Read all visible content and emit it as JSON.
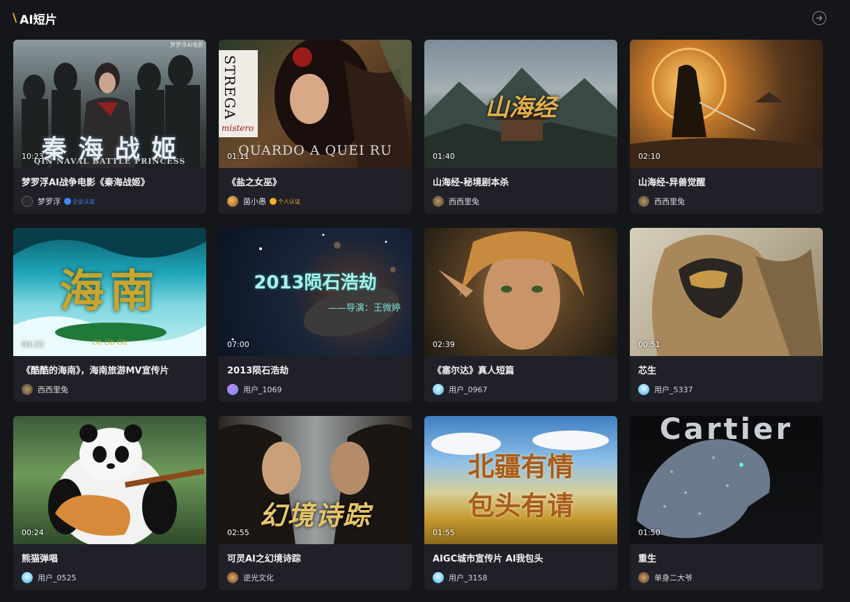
{
  "section": {
    "title": "AI短片",
    "slash": "\\"
  },
  "more_icon": "arrow-right-circle-icon",
  "videos": [
    {
      "title": "梦罗浮AI战争电影《秦海战姬》",
      "duration": "10:23",
      "author": "梦罗浮",
      "badge": "企业认证",
      "badge_color": "#3d8bff",
      "overlay": "秦 海 战 姬",
      "overlay2": "QIN NAVAL BATTLE PRINCESS",
      "corner": "梦罗浮AI电影"
    },
    {
      "title": "《盐之女巫》",
      "duration": "01:11",
      "author": "菌小愚",
      "badge": "个人认证",
      "badge_color": "#f5b31c",
      "overlay": "QUARDO A QUEI RU",
      "overlay2": "STREGA",
      "corner": "mistero"
    },
    {
      "title": "山海经-秘境剧本杀",
      "duration": "01:40",
      "author": "西西里兔",
      "badge": "",
      "overlay": "山海经"
    },
    {
      "title": "山海经-异兽觉醒",
      "duration": "02:10",
      "author": "西西里兔",
      "badge": ""
    },
    {
      "title": "《酷酷的海南》，海南旅游MV宣传片",
      "duration": "03:33",
      "author": "西西里兔",
      "badge": "",
      "overlay": "海南",
      "overlay2": "Oh Oh Oh"
    },
    {
      "title": "2013陨石浩劫",
      "duration": "07:00",
      "author": "用户_1069",
      "badge": "",
      "overlay": "2013陨石浩劫",
      "overlay2": "——导演：王微婷"
    },
    {
      "title": "《塞尔达》真人短篇",
      "duration": "02:39",
      "author": "用户_0967",
      "badge": ""
    },
    {
      "title": "芯生",
      "duration": "00:51",
      "author": "用户_5337",
      "badge": ""
    },
    {
      "title": "熊猫弹唱",
      "duration": "00:24",
      "author": "用户_0525",
      "badge": ""
    },
    {
      "title": "可灵AI之幻境诗踪",
      "duration": "02:55",
      "author": "逆光文化",
      "badge": "",
      "overlay": "幻境诗踪"
    },
    {
      "title": "AIGC城市宣传片 AI我包头",
      "duration": "01:55",
      "author": "用户_3158",
      "badge": "",
      "overlay": "北疆有情",
      "overlay2": "包头有请"
    },
    {
      "title": "重生",
      "duration": "01:50",
      "author": "单身二大爷",
      "badge": "",
      "overlay": "Cartier"
    }
  ]
}
